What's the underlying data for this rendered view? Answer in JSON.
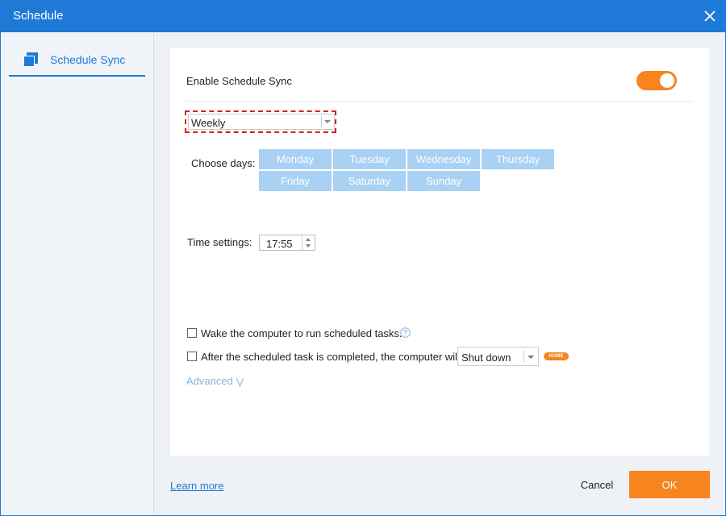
{
  "window": {
    "title": "Schedule",
    "close_icon": "close-icon"
  },
  "sidebar": {
    "items": [
      {
        "label": "Schedule Sync",
        "icon": "schedule-sync-icon",
        "active": true
      }
    ]
  },
  "schedule": {
    "enable_label": "Enable Schedule Sync",
    "enabled": true,
    "frequency": "Weekly",
    "choose_days_label": "Choose days:",
    "days": [
      "Monday",
      "Tuesday",
      "Wednesday",
      "Thursday",
      "Friday",
      "Saturday",
      "Sunday"
    ],
    "time_label": "Time settings:",
    "time_value": "17:55",
    "wake_label": "Wake the computer to run scheduled tasks.",
    "wake_checked": false,
    "after_label": "After the scheduled task is completed, the computer will",
    "after_checked": false,
    "after_action": "Shut down",
    "home_badge": "HOME",
    "advanced_label": "Advanced"
  },
  "footer": {
    "learn_more": "Learn more",
    "cancel": "Cancel",
    "ok": "OK"
  },
  "colors": {
    "accent": "#1e7ad6",
    "orange": "#f7841f",
    "day_button": "#a9d1f3",
    "highlight_dash": "#d51f1f"
  }
}
